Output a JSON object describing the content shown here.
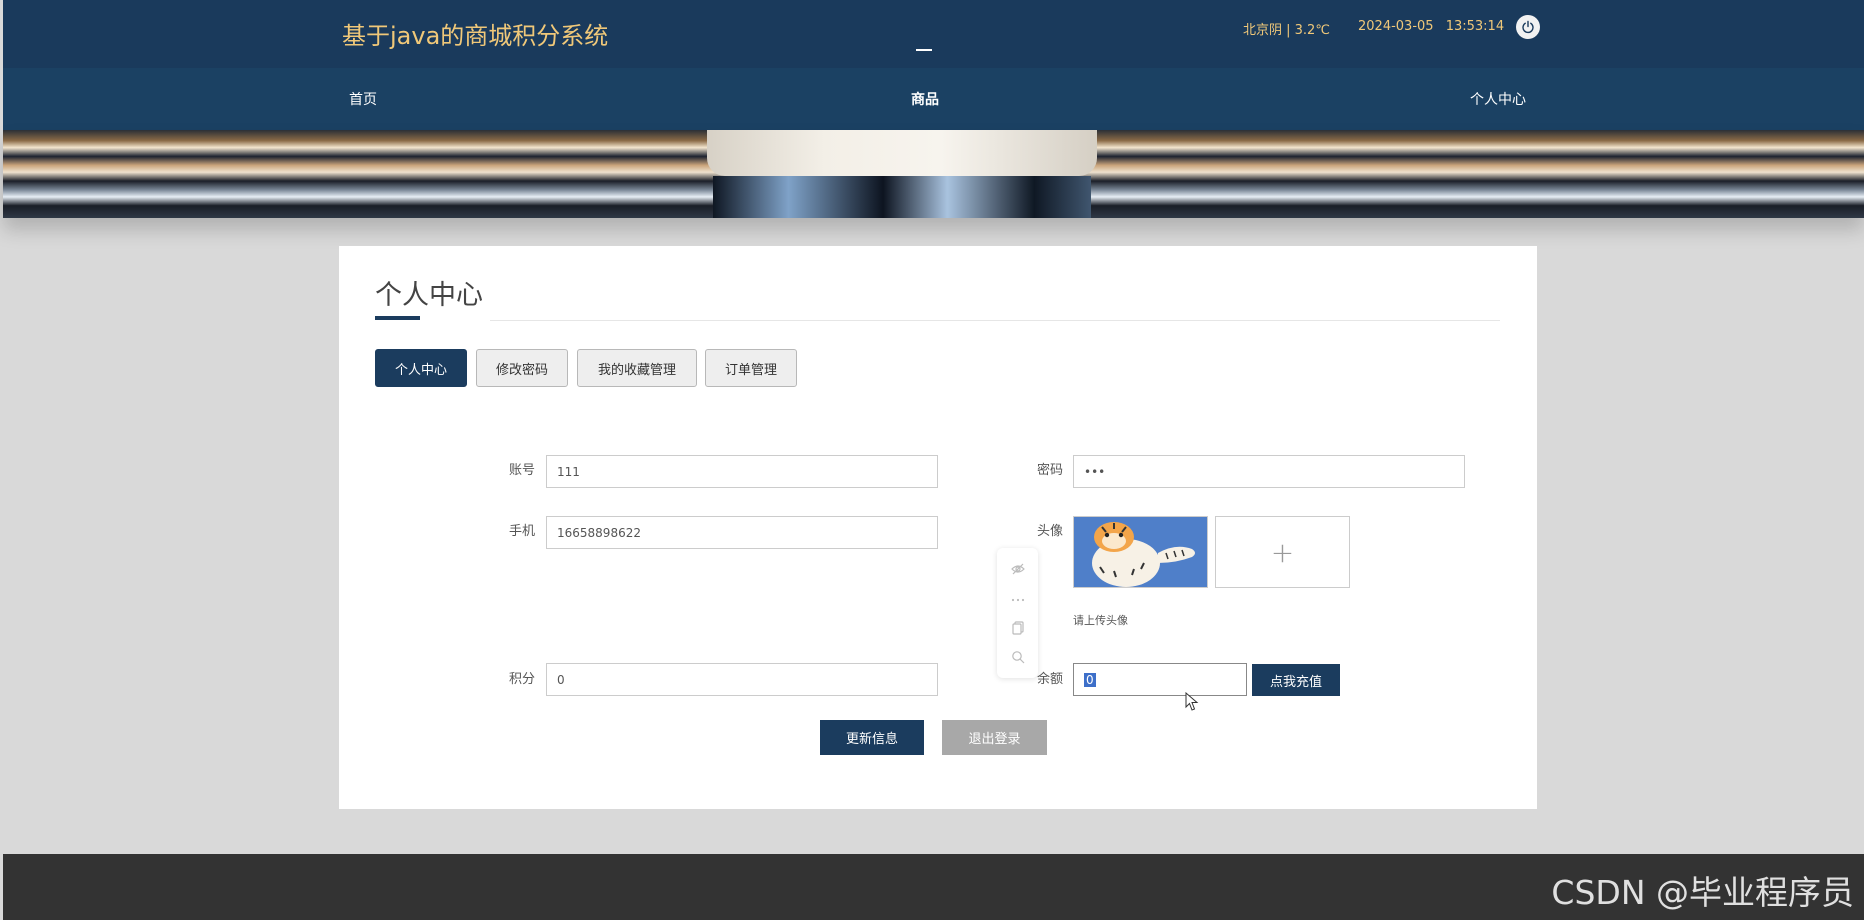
{
  "header": {
    "title": "基于java的商城积分系统",
    "weather": "北京阴 | 3.2℃",
    "date": "2024-03-05",
    "time": "13:53:14",
    "power_icon": "power-icon"
  },
  "nav": {
    "items": [
      {
        "label": "首页"
      },
      {
        "label": "商品"
      },
      {
        "label": "个人中心"
      }
    ],
    "active": "商品"
  },
  "main": {
    "title": "个人中心",
    "tabs": [
      {
        "label": "个人中心",
        "active": true
      },
      {
        "label": "修改密码",
        "active": false
      },
      {
        "label": "我的收藏管理",
        "active": false
      },
      {
        "label": "订单管理",
        "active": false
      }
    ],
    "form": {
      "account": {
        "label": "账号",
        "value": "111"
      },
      "password": {
        "label": "密码",
        "value": "•••"
      },
      "phone": {
        "label": "手机",
        "value": "16658898622"
      },
      "avatar": {
        "label": "头像",
        "hint": "请上传头像",
        "add_symbol": "+"
      },
      "points": {
        "label": "积分",
        "value": "0"
      },
      "balance": {
        "label": "余额",
        "value": "0"
      },
      "recharge_label": "点我充值"
    },
    "buttons": {
      "update": "更新信息",
      "logout": "退出登录"
    }
  },
  "floating_toolbar": {
    "icons": [
      "eye-off-icon",
      "more-icon",
      "copy-icon",
      "search-icon"
    ]
  },
  "footer": {
    "watermark": "CSDN @毕业程序员"
  },
  "colors": {
    "header_bg": "#1a3a5c",
    "nav_bg": "#1b4163",
    "accent": "#1b3c5e",
    "title_gold": "#f0c879"
  }
}
